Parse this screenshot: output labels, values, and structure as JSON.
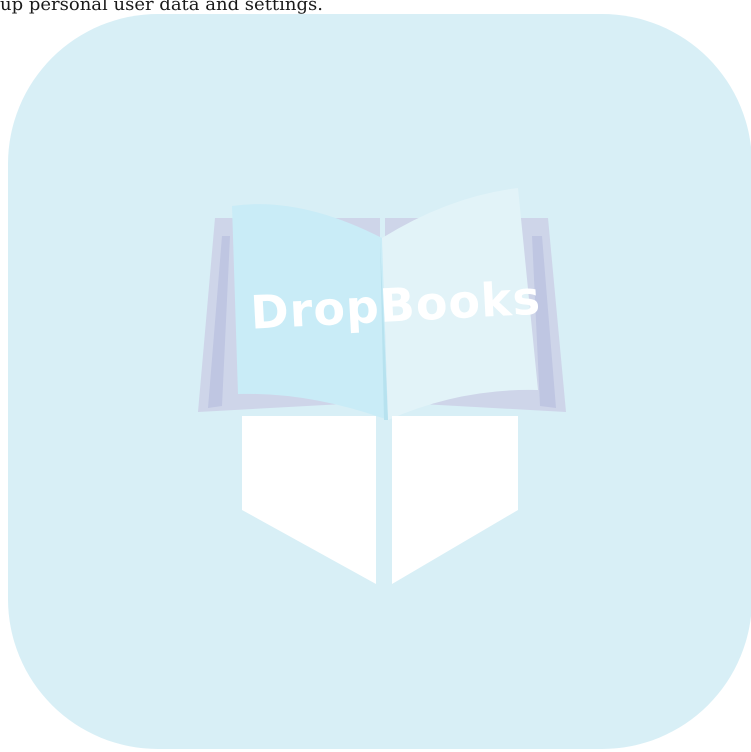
{
  "page": {
    "top_text": "up personal user data and settings."
  },
  "logo": {
    "icon": "open-book-icon",
    "wordmark": "DropBooks"
  },
  "colors": {
    "tile": "#d8eff6",
    "book_left_page": "#c9ecf7",
    "book_right_page": "#dff2f7",
    "book_spine_purple": "#c8cfe6",
    "book_bookmark": "#ffffff",
    "wordmark": "#ffffff"
  }
}
